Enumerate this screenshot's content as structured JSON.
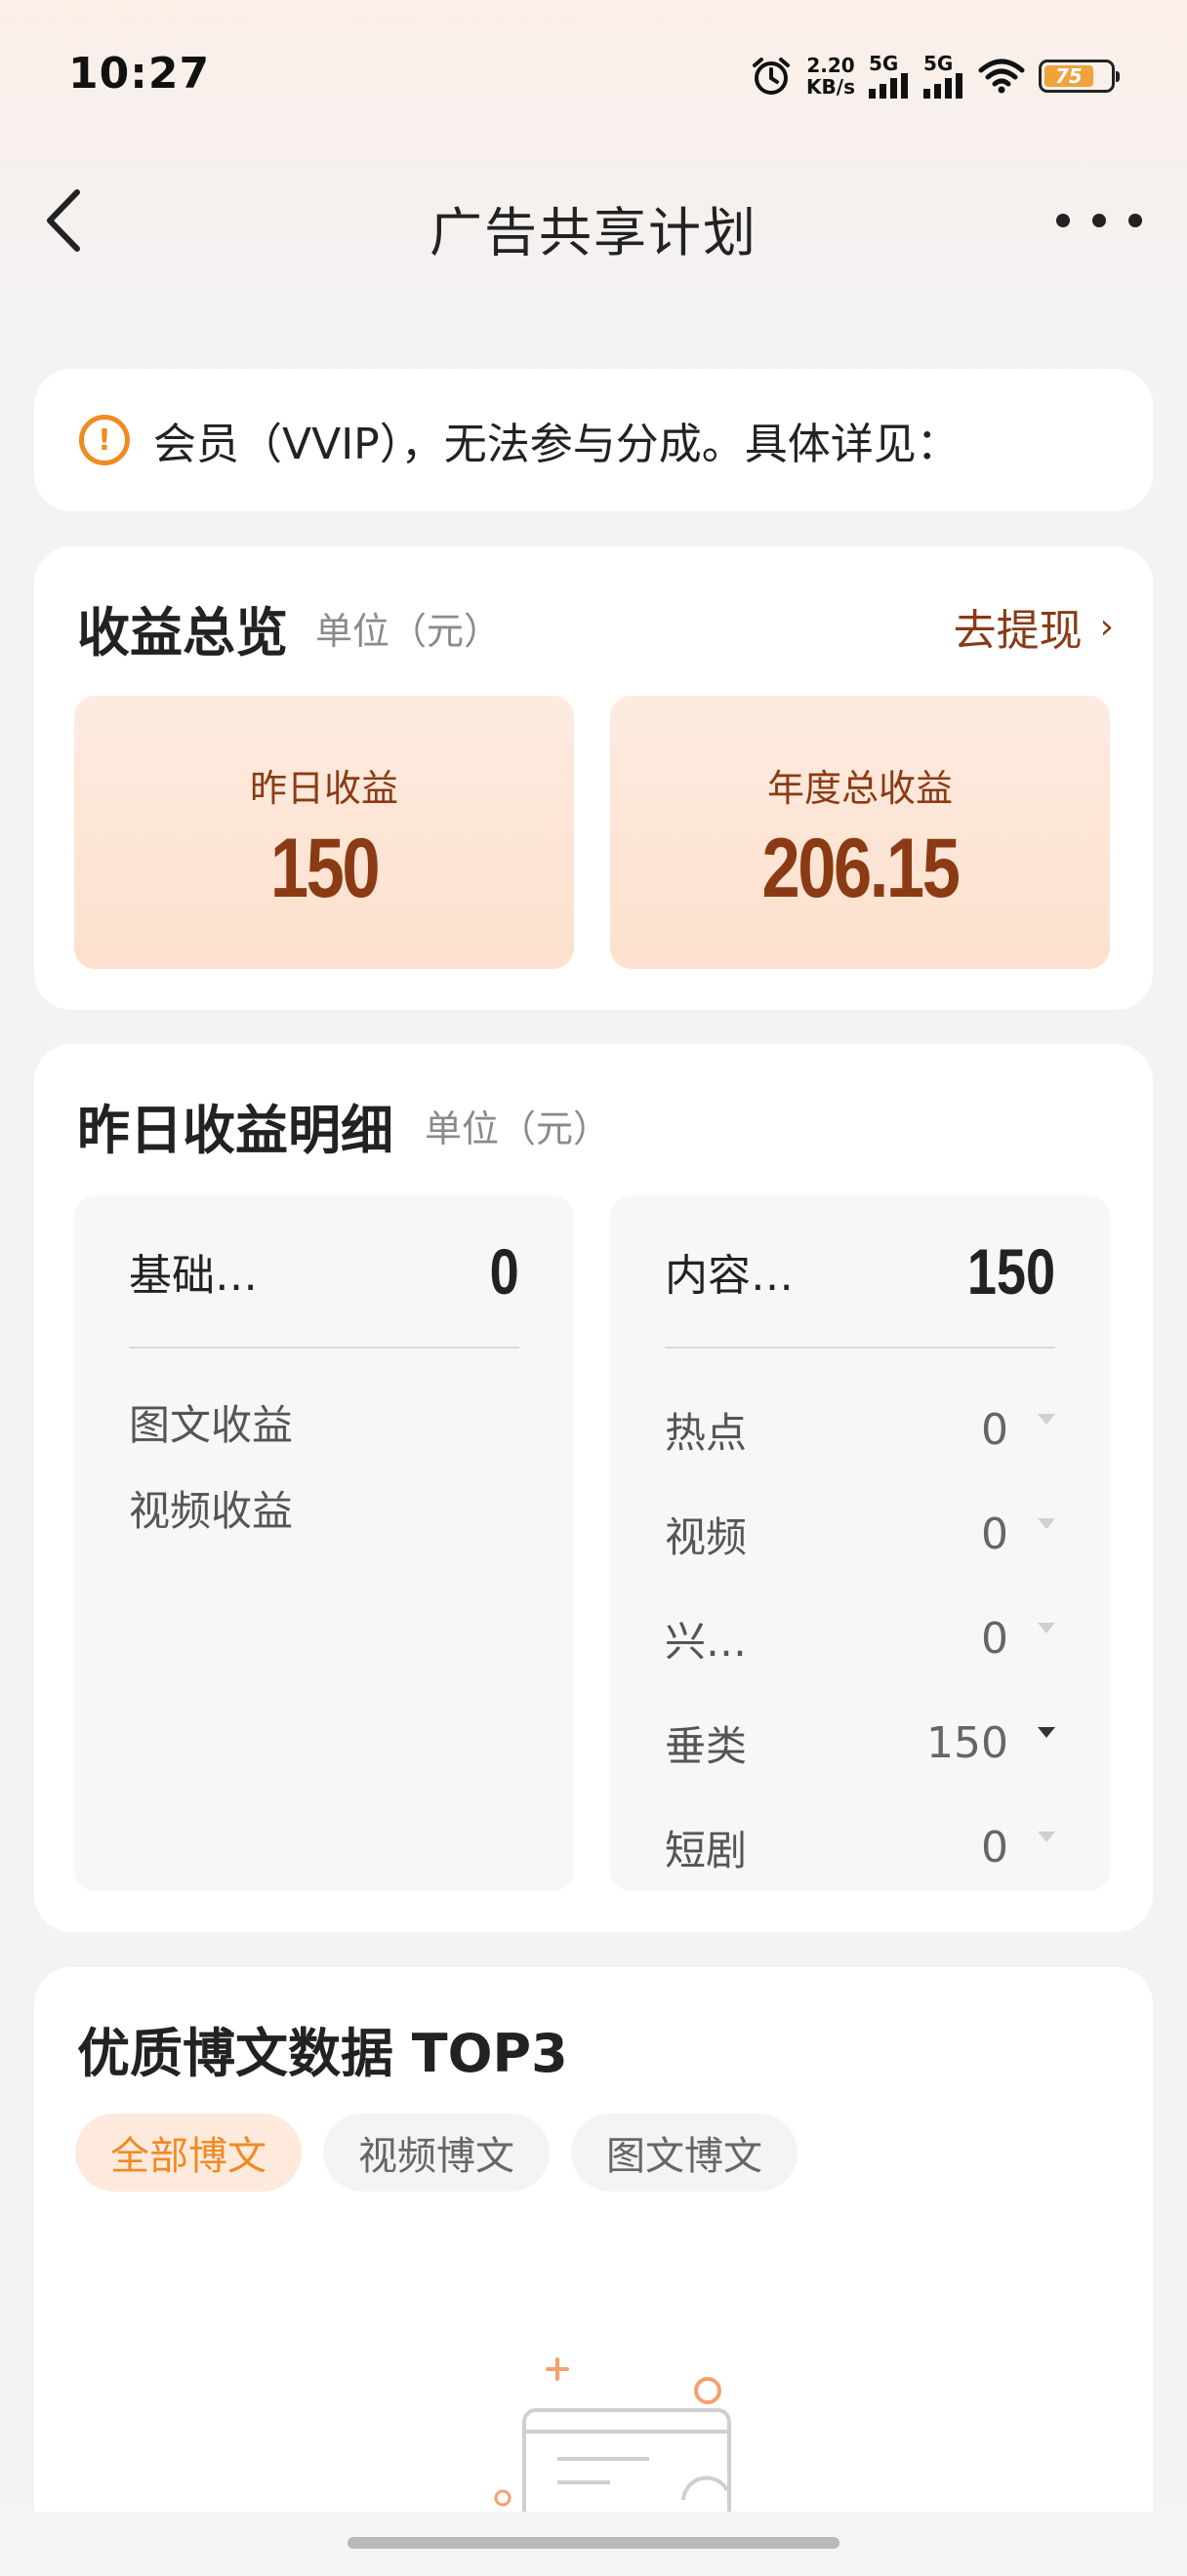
{
  "status_bar": {
    "time": "10:27",
    "speed_value": "2.20",
    "speed_unit": "KB/s",
    "signal_1": "5G",
    "signal_2": "5G",
    "battery": "75"
  },
  "nav": {
    "title": "广告共享计划"
  },
  "notice": {
    "text": "会员（VVIP），无法参与分成。具体详见："
  },
  "overview": {
    "title": "收益总览",
    "unit": "单位（元）",
    "withdraw_label": "去提现",
    "yesterday_label": "昨日收益",
    "yesterday_value": "150",
    "annual_label": "年度总收益",
    "annual_value": "206.15"
  },
  "detail": {
    "title": "昨日收益明细",
    "unit": "单位（元）",
    "basic": {
      "name": "基础…",
      "value": "0",
      "items": [
        "图文收益",
        "视频收益"
      ]
    },
    "content": {
      "name": "内容…",
      "value": "150",
      "rows": [
        {
          "name": "热点",
          "value": "0",
          "expanded": false
        },
        {
          "name": "视频",
          "value": "0",
          "expanded": false
        },
        {
          "name": "兴…",
          "value": "0",
          "expanded": false
        },
        {
          "name": "垂类",
          "value": "150",
          "expanded": true
        },
        {
          "name": "短剧",
          "value": "0",
          "expanded": false
        }
      ]
    }
  },
  "top3": {
    "title": "优质博文数据 TOP3",
    "tabs": [
      "全部博文",
      "视频博文",
      "图文博文"
    ],
    "active_tab": "全部博文"
  },
  "colors": {
    "accent_orange": "#f08a24",
    "brown_text": "#8a3b14",
    "card_peach": "#fde6d6"
  }
}
